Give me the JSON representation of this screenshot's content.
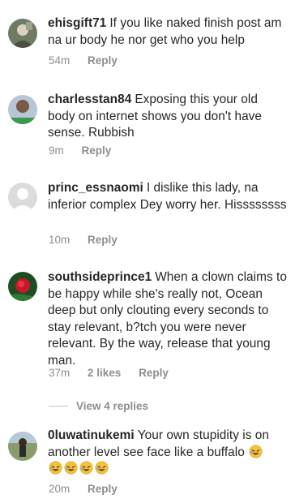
{
  "comments": [
    {
      "username": "ehisgift71",
      "text": "If you like naked finish post am na ur body he nor get who you help",
      "time": "54m",
      "likes": "",
      "reply": "Reply"
    },
    {
      "username": "charlesstan84",
      "text": "Exposing this your old body on internet shows you don't have sense. Rubbish",
      "time": "9m",
      "likes": "",
      "reply": "Reply"
    },
    {
      "username": "princ_essnaomi",
      "text": "I dislike this lady, na inferior complex Dey worry her. Hissssssss",
      "time": "10m",
      "likes": "",
      "reply": "Reply"
    },
    {
      "username": "southsideprince1",
      "text": "When a clown claims to be happy while she's really not, Ocean deep but only clouting every seconds to stay relevant, b?tch you were never relevant. By the way, release that young man.",
      "time": "37m",
      "likes": "2 likes",
      "reply": "Reply"
    },
    {
      "username": "0luwatinukemi",
      "text": "Your  own stupidity is on another level  see  face  like a buffalo",
      "time": "20m",
      "likes": "",
      "reply": "Reply"
    }
  ],
  "view_replies": "View 4 replies",
  "emoji_name": "rolling-on-floor-laughing-emoji",
  "colors": {
    "text": "#262626",
    "meta": "#8e8e8e",
    "emoji": "#f5c33b"
  }
}
